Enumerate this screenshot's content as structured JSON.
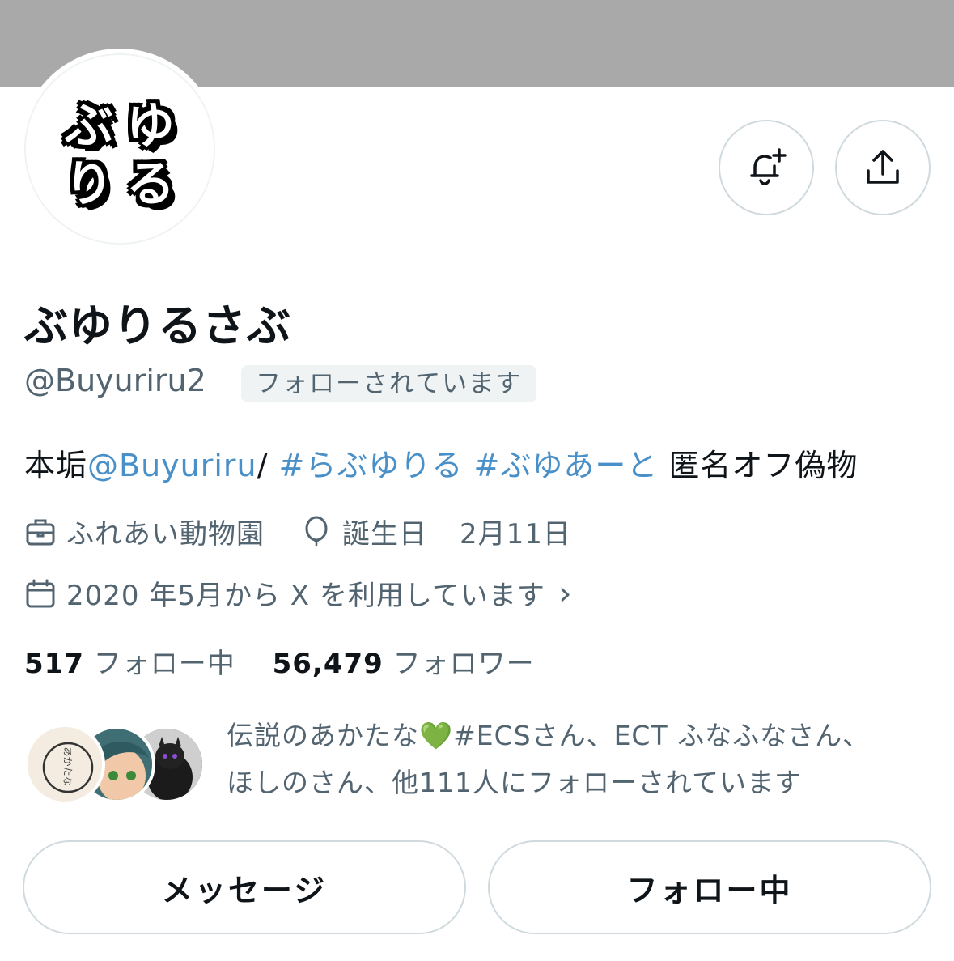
{
  "profile": {
    "display_name": "ぶゆりるさぶ",
    "handle": "@Buyuriru2",
    "follows_you_badge": "フォローされています",
    "avatar_glyphs": [
      "ぶ",
      "ゆ",
      "り",
      "る"
    ]
  },
  "bio": {
    "prefix": "本垢",
    "mention": "@Buyuriru",
    "slash": "/",
    "hashtag1": "#らぶゆりる",
    "hashtag2": "#ぶゆあーと",
    "suffix": "匿名オフ偽物"
  },
  "meta": {
    "work": "ふれあい動物園",
    "birthday_label": "誕生日",
    "birthday_value": "2月11日",
    "joined": "2020 年5月から X を利用しています",
    "chevron": "›"
  },
  "stats": {
    "following_count": "517",
    "following_label": "フォロー中",
    "followers_count": "56,479",
    "followers_label": "フォロワー"
  },
  "mutuals": {
    "text_line1": "伝説のあかたな💚#ECSさん、ECT ふなふなさん、",
    "text_line2": "ほしのさん、他111人にフォローされています",
    "avatar1_text": "あかたな"
  },
  "buttons": {
    "message": "メッセージ",
    "following": "フォロー中"
  },
  "icons": {
    "notify": "bell-plus-icon",
    "share": "share-icon",
    "work": "briefcase-icon",
    "birthday": "balloon-icon",
    "joined": "calendar-icon"
  },
  "colors": {
    "link": "#4a90c8",
    "secondary_text": "#536471",
    "banner": "#a9a9a9"
  }
}
